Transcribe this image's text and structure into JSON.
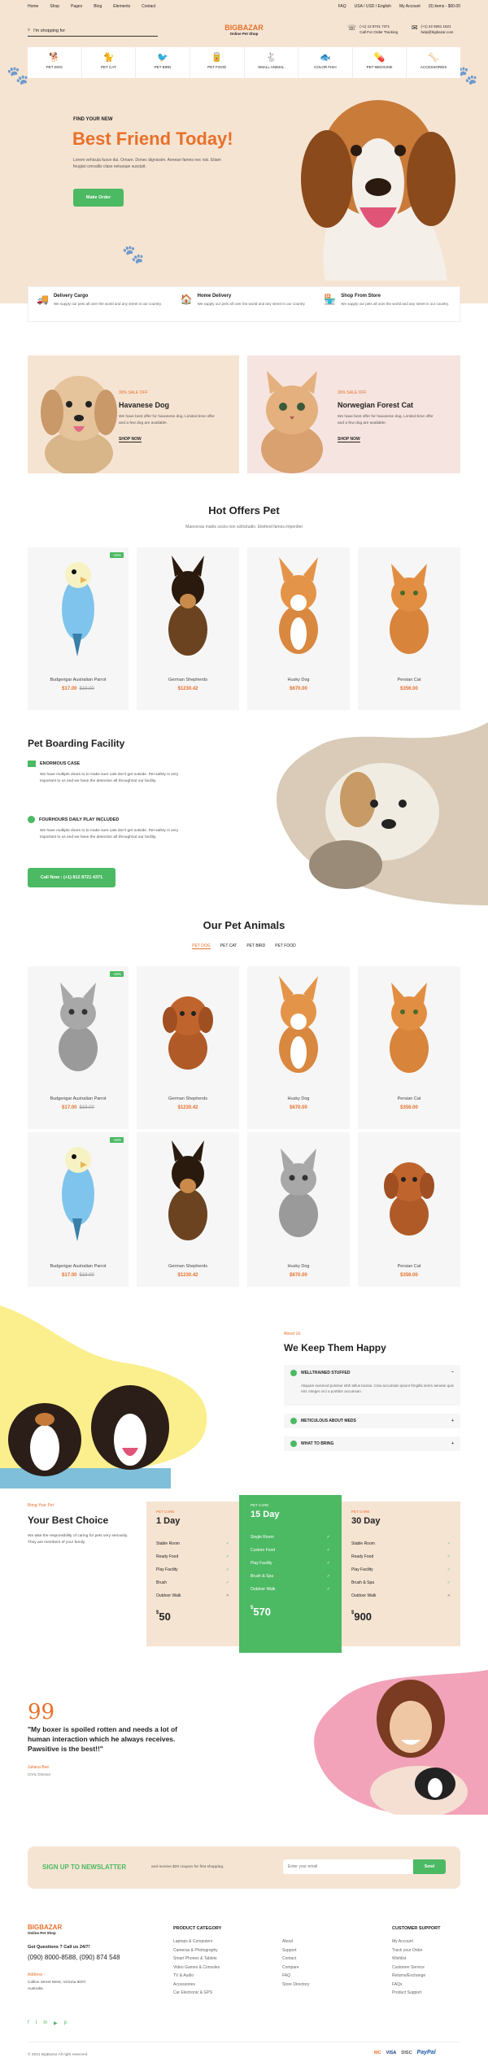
{
  "topbar": {
    "links": [
      "Home",
      "Shop",
      "Pages",
      "Blog",
      "Elements",
      "Contact"
    ],
    "right": [
      "FAQ",
      "USA / USD / English",
      "My Account",
      "(0) items - $00.00"
    ]
  },
  "header": {
    "search_placeholder": "I'm shopping for",
    "logo": "BIGBAZAR",
    "logo_sub": "Online Pet Shop",
    "phone1": "(+1) 12 8741 7371",
    "phone1_sub": "Call For Order Tracking",
    "phone2": "(+1) 22 9281 1521",
    "phone2_sub": "help@bigbazar.com"
  },
  "categories": [
    "PET DOG",
    "PET CAT",
    "PET BIRD",
    "PET FOOD",
    "SMALL ANIMAL",
    "COLOR FISH",
    "PET MEDICINE",
    "ACCESSORIES"
  ],
  "hero": {
    "kicker": "FIND YOUR NEW",
    "title": "Best Friend Today!",
    "text": "Lorem vehicula fusce dui. Ornare. Donec dignissim. Aenean fames nec nisi. Etiam feugiat convallis class netusque suscipit.",
    "button": "Make Order"
  },
  "features": [
    {
      "title": "Delivery Cargo",
      "text": "We supply our pets all over the world and any street in our country."
    },
    {
      "title": "Home Delivery",
      "text": "We supply our pets all over the world and any street in our country."
    },
    {
      "title": "Shop From Store",
      "text": "We supply our pets all over the world and any street in our country."
    }
  ],
  "promos": [
    {
      "tag": "30% SALE OFF",
      "title": "Havanese Dog",
      "text": "We have best offer for havanese dog. Limited time offer and a few dog are available.",
      "link": "SHOP NOW"
    },
    {
      "tag": "30% SALE OFF",
      "title": "Norwegian Forest Cat",
      "text": "We have best offer for havanese dog. Limited time offer and a few dog are available.",
      "link": "SHOP NOW"
    }
  ],
  "hot": {
    "title": "Hot Offers Pet",
    "subtitle": "Maecenas mattis sociis non sollicitudin. Eleifend fames imperdiet",
    "items": [
      {
        "name": "Budgerigar Australian Parrot",
        "price": "$17.00",
        "old": "$19.00",
        "badge": "-15%"
      },
      {
        "name": "German Shepherds",
        "price": "$1230.42"
      },
      {
        "name": "Husky Dog",
        "price": "$670.00"
      },
      {
        "name": "Persian Cat",
        "price": "$356.00"
      }
    ]
  },
  "boarding": {
    "title": "Pet Boarding Facility",
    "items": [
      {
        "title": "ENORMOUS CASE",
        "text": "We have multiple doors to to make sure cats don't get outside. Pet safety is very important to us and we have the detection all throughout our facility."
      },
      {
        "title": "FOURHOURS DAILY PLAY INCLUDED",
        "text": "We have multiple doors to to make sure cats don't get outside. Pet safety is very important to us and we have the detection all throughout our facility."
      }
    ],
    "button": "Call Now : (+1) 812 8721 4371"
  },
  "animals": {
    "title": "Our Pet Animals",
    "tabs": [
      "PET DOG",
      "PET CAT",
      "PET BIRD",
      "PET FOOD"
    ],
    "items": [
      {
        "name": "Budgerigar Australian Parrot",
        "price": "$17.00",
        "old": "$19.00",
        "badge": "-15%"
      },
      {
        "name": "German Shepherds",
        "price": "$1230.42"
      },
      {
        "name": "Husky Dog",
        "price": "$670.00"
      },
      {
        "name": "Persian Cat",
        "price": "$356.00"
      },
      {
        "name": "Budgerigar Australian Parrot",
        "price": "$17.00",
        "old": "$19.00",
        "badge": "-15%"
      },
      {
        "name": "German Shepherds",
        "price": "$1230.42"
      },
      {
        "name": "Husky Dog",
        "price": "$670.00"
      },
      {
        "name": "Persian Cat",
        "price": "$356.00"
      }
    ]
  },
  "about": {
    "kicker": "About Us",
    "title": "We Keep Them Happy",
    "items": [
      {
        "title": "WELLTRAINED STUFFED",
        "text": "Aliquam euismod pulvinar nibh tellus lacinia. Cras accumsan ipsum fringilla lorem aenean quis nisl. Integer orci a porttitor accumsan."
      },
      {
        "title": "METICULOUS ABOUT MEDS"
      },
      {
        "title": "WHAT TO BRING"
      }
    ]
  },
  "pricing": {
    "kicker": "Bring Your Pet",
    "title": "Your Best Choice",
    "text": "We take the responsibility of caring for pets very seriously. They are members of your family.",
    "plans": [
      {
        "label": "PET CARE",
        "days": "1 Day",
        "rows": [
          "Stable Room",
          "Ready Food",
          "Play Facility",
          "Brush",
          "Outdoor Walk"
        ],
        "marks": [
          "check",
          "check",
          "check",
          "check",
          "x"
        ],
        "price": "50"
      },
      {
        "label": "PET CARE",
        "days": "15 Day",
        "rows": [
          "Single Room",
          "Custom Food",
          "Play Facility",
          "Brush & Spa",
          "Outdoor Walk"
        ],
        "marks": [
          "check",
          "check",
          "check",
          "check",
          "check"
        ],
        "price": "570"
      },
      {
        "label": "PET CARE",
        "days": "30 Day",
        "rows": [
          "Stable Room",
          "Ready Food",
          "Play Facility",
          "Brush & Spa",
          "Outdoor Walk"
        ],
        "marks": [
          "check",
          "check",
          "check",
          "check",
          "x"
        ],
        "price": "900"
      }
    ]
  },
  "testimonial": {
    "quote": "\"My boxer is spoiled rotten and needs a lot of human interaction which he always receives. Pawsitive is the best!!\"",
    "name": "Juliana Bee",
    "role": "CIVIL Director"
  },
  "newsletter": {
    "title": "SIGN UP TO NEWSLATTER",
    "text": "and receive $20 coupon for first shopping.",
    "placeholder": "Enter your email",
    "button": "Send"
  },
  "footer": {
    "logo": "BIGBAZAR",
    "logo_sub": "Online Pet Shop",
    "q": "Got Questions ? Call us 24/7!",
    "phones": "(090) 8000-8588, (090) 874 548",
    "addr_label": "Address :",
    "addr": "Collins Street West, Victoria 8007, Australia",
    "cols": [
      {
        "title": "PRODUCT CATEGORY",
        "links": [
          "Laptops & Computers",
          "Cameras & Photography",
          "Smart Phones & Tablets",
          "Video Games & Consoles",
          "TV & Audio",
          "Accessories",
          "Car Electronic & GPS"
        ]
      },
      {
        "title": "",
        "links": [
          "About",
          "Support",
          "Contact",
          "Compare",
          "FAQ",
          "Store Directory"
        ]
      },
      {
        "title": "CUSTOMER SUPPORT",
        "links": [
          "My Account",
          "Track your Order",
          "Wishlist",
          "Customer Service",
          "Returns/Exchange",
          "FAQs",
          "Product Support"
        ]
      }
    ],
    "copyright": "© 2021 BigBazar All right reserved",
    "payments": [
      "MC",
      "VISA",
      "DISC",
      "PayPal"
    ]
  },
  "colors": {
    "accent": "#e8702a",
    "green": "#4cb963",
    "peach": "#f6e4d3",
    "yellow": "#fbef8d",
    "pink": "#f2a3b9"
  }
}
